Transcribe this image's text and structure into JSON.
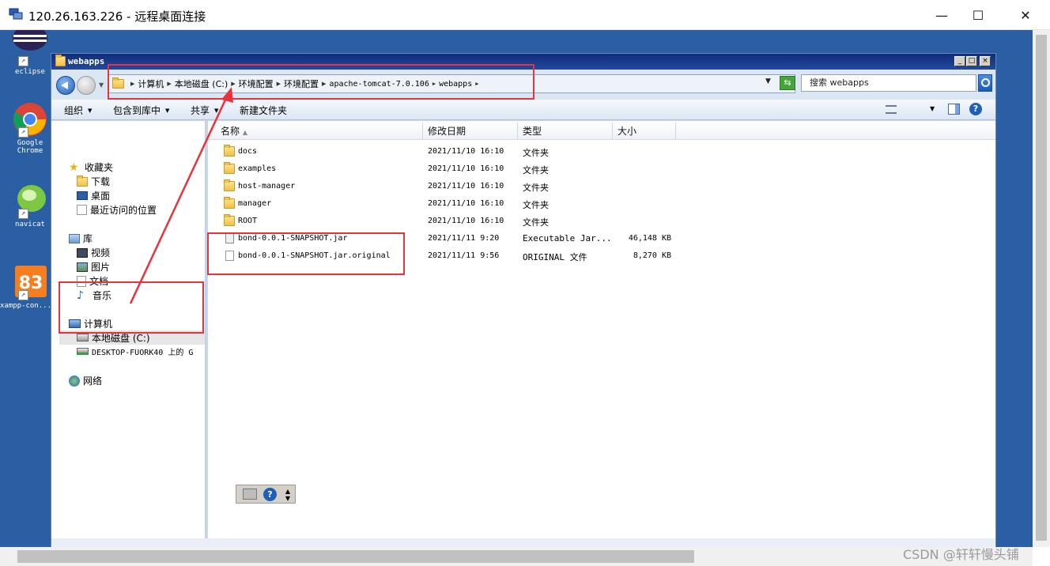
{
  "rdp": {
    "title": "120.26.163.226 - 远程桌面连接",
    "minimize": "—",
    "maximize": "☐",
    "close": "✕"
  },
  "desktop": {
    "icons": [
      {
        "name": "eclipse",
        "label": "eclipse"
      },
      {
        "name": "google-chrome",
        "label": "Google Chrome"
      },
      {
        "name": "navicat",
        "label": "navicat"
      },
      {
        "name": "xampp",
        "label": "xampp-con..."
      }
    ]
  },
  "explorer": {
    "title": "webapps",
    "breadcrumbs": [
      "计算机",
      "本地磁盘 (C:)",
      "环境配置",
      "环境配置",
      "apache-tomcat-7.0.106",
      "webapps"
    ],
    "search_placeholder": "搜索 webapps",
    "toolbar": {
      "organize": "组织",
      "include_in_library": "包含到库中",
      "share": "共享",
      "new_folder": "新建文件夹"
    },
    "nav": {
      "favorites": "收藏夹",
      "downloads": "下载",
      "desktop": "桌面",
      "recent": "最近访问的位置",
      "libraries": "库",
      "videos": "视频",
      "pictures": "图片",
      "documents": "文档",
      "music": "音乐",
      "computer": "计算机",
      "local_disk": "本地磁盘 (C:)",
      "network_drive": "DESKTOP-FUORK40 上的 G",
      "network": "网络"
    },
    "columns": {
      "name": "名称",
      "modified": "修改日期",
      "type": "类型",
      "size": "大小"
    },
    "files": [
      {
        "name": "docs",
        "date": "2021/11/10 16:10",
        "type": "文件夹",
        "size": "",
        "icon": "folder"
      },
      {
        "name": "examples",
        "date": "2021/11/10 16:10",
        "type": "文件夹",
        "size": "",
        "icon": "folder"
      },
      {
        "name": "host-manager",
        "date": "2021/11/10 16:10",
        "type": "文件夹",
        "size": "",
        "icon": "folder"
      },
      {
        "name": "manager",
        "date": "2021/11/10 16:10",
        "type": "文件夹",
        "size": "",
        "icon": "folder"
      },
      {
        "name": "ROOT",
        "date": "2021/11/10 16:10",
        "type": "文件夹",
        "size": "",
        "icon": "folder"
      },
      {
        "name": "bond-0.0.1-SNAPSHOT.jar",
        "date": "2021/11/11 9:20",
        "type": "Executable Jar...",
        "size": "46,148 KB",
        "icon": "jar"
      },
      {
        "name": "bond-0.0.1-SNAPSHOT.jar.original",
        "date": "2021/11/11 9:56",
        "type": "ORIGINAL 文件",
        "size": "8,270 KB",
        "icon": "file"
      }
    ]
  },
  "watermark": "CSDN @轩轩慢头铺",
  "colors": {
    "desktop_bg": "#2b5fa3",
    "annotation_red": "#e8323c",
    "title_bar": "#0f2d7a"
  }
}
